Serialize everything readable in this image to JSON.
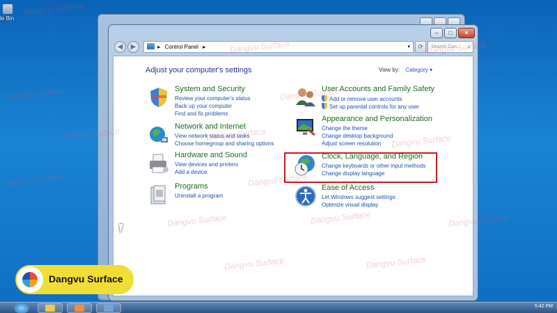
{
  "desktop": {
    "recycle_label": "le Bin"
  },
  "window": {
    "minimize": "–",
    "maximize": "□",
    "close": "×"
  },
  "address_bar": {
    "back": "◀",
    "forward": "▶",
    "breadcrumb_arrow": "▸",
    "breadcrumb": "Control Panel",
    "breadcrumb_trail_arrow": "▸",
    "dropdown": "▾",
    "refresh": "⟳",
    "search_placeholder": "Search Con...",
    "search_icon": "⌕"
  },
  "header": {
    "title": "Adjust your computer's settings",
    "view_by_label": "View by:",
    "view_by_value": "Category ▾"
  },
  "categories": [
    {
      "title": "System and Security",
      "links": [
        "Review your computer's status",
        "Back up your computer",
        "Find and fix problems"
      ],
      "icon": "shield-flag-icon"
    },
    {
      "title": "Network and Internet",
      "links": [
        "View network status and tasks",
        "Choose homegroup and sharing options"
      ],
      "icon": "globe-network-icon"
    },
    {
      "title": "Hardware and Sound",
      "links": [
        "View devices and printers",
        "Add a device"
      ],
      "icon": "printer-icon"
    },
    {
      "title": "Programs",
      "links": [
        "Uninstall a program"
      ],
      "icon": "programs-icon"
    },
    {
      "title": "User Accounts and Family Safety",
      "links": [
        "Add or remove user accounts",
        "Set up parental controls for any user"
      ],
      "icon": "users-icon"
    },
    {
      "title": "Appearance and Personalization",
      "links": [
        "Change the theme",
        "Change desktop background",
        "Adjust screen resolution"
      ],
      "icon": "monitor-icon"
    },
    {
      "title": "Clock, Language, and Region",
      "links": [
        "Change keyboards or other input methods",
        "Change display language"
      ],
      "icon": "clock-globe-icon"
    },
    {
      "title": "Ease of Access",
      "links": [
        "Let Windows suggest settings",
        "Optimize visual display"
      ],
      "icon": "ease-of-access-icon"
    }
  ],
  "taskbar": {
    "clock": "5:42 PM"
  },
  "branding": {
    "name": "Dangvu Surface",
    "watermark": "Dangvu Surface"
  },
  "colors": {
    "category_title": "#1f6b1f",
    "link": "#1c4fae",
    "heading": "#1e3287",
    "highlight": "#c8181e"
  }
}
